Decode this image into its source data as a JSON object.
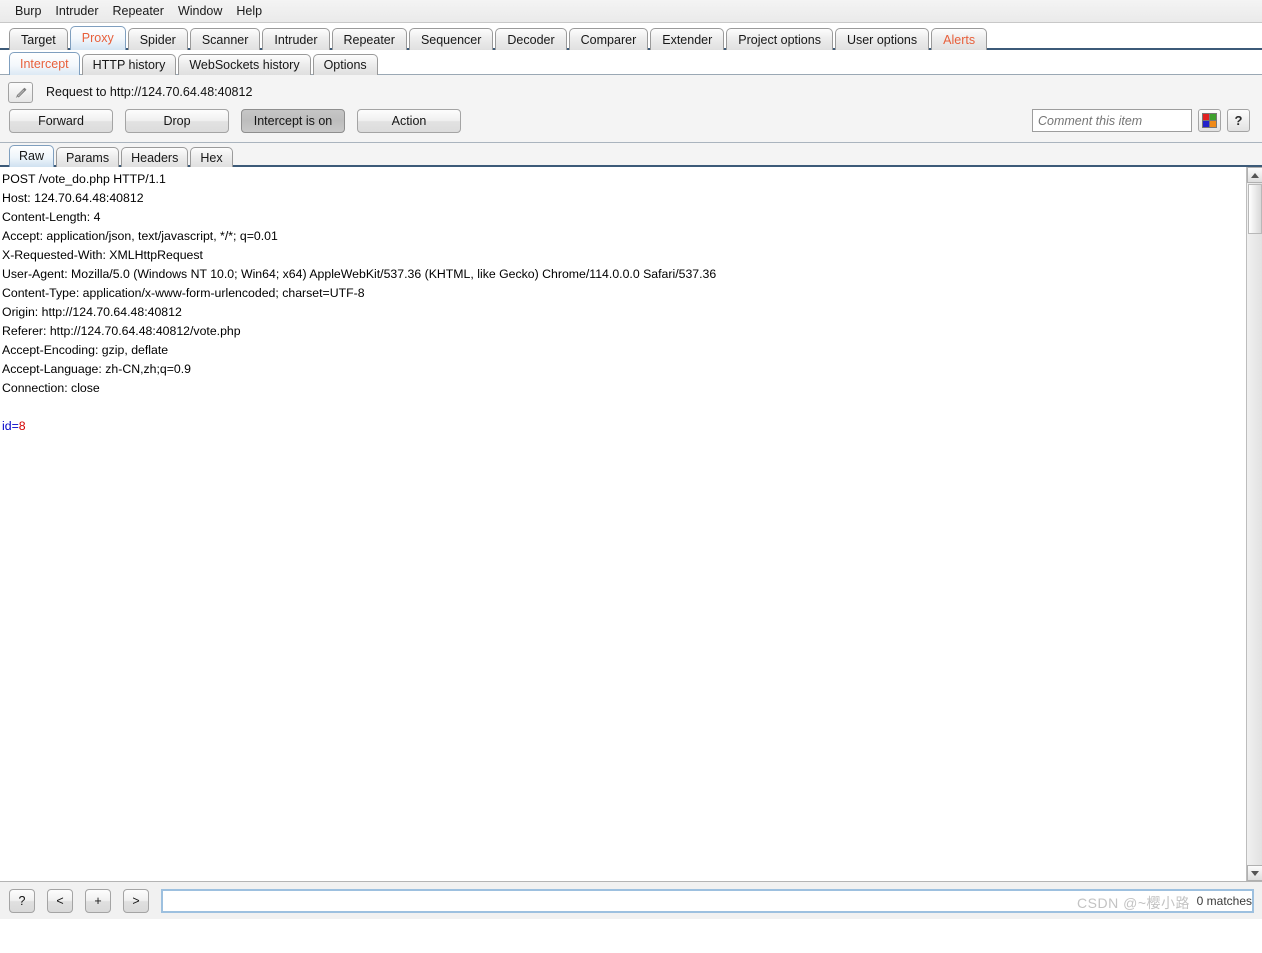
{
  "app": {
    "name": "Burp Suite",
    "accent_orange": "#e8603c",
    "tab_underline": "#3c5a78"
  },
  "menubar": {
    "items": [
      {
        "label": "Burp"
      },
      {
        "label": "Intruder"
      },
      {
        "label": "Repeater"
      },
      {
        "label": "Window"
      },
      {
        "label": "Help"
      }
    ]
  },
  "main_tabs": {
    "selected": "Proxy",
    "items": [
      {
        "label": "Target",
        "state": "normal"
      },
      {
        "label": "Proxy",
        "state": "selected"
      },
      {
        "label": "Spider",
        "state": "normal"
      },
      {
        "label": "Scanner",
        "state": "normal"
      },
      {
        "label": "Intruder",
        "state": "normal"
      },
      {
        "label": "Repeater",
        "state": "normal"
      },
      {
        "label": "Sequencer",
        "state": "normal"
      },
      {
        "label": "Decoder",
        "state": "normal"
      },
      {
        "label": "Comparer",
        "state": "normal"
      },
      {
        "label": "Extender",
        "state": "normal"
      },
      {
        "label": "Project options",
        "state": "normal"
      },
      {
        "label": "User options",
        "state": "normal"
      },
      {
        "label": "Alerts",
        "state": "alert"
      }
    ]
  },
  "sub_tabs": {
    "selected": "Intercept",
    "items": [
      {
        "label": "Intercept",
        "state": "selected"
      },
      {
        "label": "HTTP history",
        "state": "normal"
      },
      {
        "label": "WebSockets history",
        "state": "normal"
      },
      {
        "label": "Options",
        "state": "normal"
      }
    ]
  },
  "intercept": {
    "edit_icon": "pencil-icon",
    "request_title": "Request to http://124.70.64.48:40812",
    "buttons": [
      {
        "label": "Forward",
        "pressed": false
      },
      {
        "label": "Drop",
        "pressed": false
      },
      {
        "label": "Intercept is on",
        "pressed": true
      },
      {
        "label": "Action",
        "pressed": false
      }
    ],
    "comment_placeholder": "Comment this item",
    "comment_value": "",
    "highlight_icon": "color-swatch-icon",
    "highlight_colors": {
      "top_left": "#e02020",
      "top_right": "#3fa02e",
      "bottom_left": "#2222cc",
      "bottom_right": "#f08a18"
    },
    "help_button_label": "?"
  },
  "message_tabs": {
    "selected": "Raw",
    "items": [
      {
        "label": "Raw",
        "state": "selected"
      },
      {
        "label": "Params",
        "state": "normal"
      },
      {
        "label": "Headers",
        "state": "normal"
      },
      {
        "label": "Hex",
        "state": "normal"
      }
    ]
  },
  "request": {
    "lines": [
      "POST /vote_do.php HTTP/1.1",
      "Host: 124.70.64.48:40812",
      "Content-Length: 4",
      "Accept: application/json, text/javascript, */*; q=0.01",
      "X-Requested-With: XMLHttpRequest",
      "User-Agent: Mozilla/5.0 (Windows NT 10.0; Win64; x64) AppleWebKit/537.36 (KHTML, like Gecko) Chrome/114.0.0.0 Safari/537.36",
      "Content-Type: application/x-www-form-urlencoded; charset=UTF-8",
      "Origin: http://124.70.64.48:40812",
      "Referer: http://124.70.64.48:40812/vote.php",
      "Accept-Encoding: gzip, deflate",
      "Accept-Language: zh-CN,zh;q=0.9",
      "Connection: close"
    ],
    "body_param_name": "id",
    "body_equals": "=",
    "body_param_value": "8",
    "body_name_color": "#0000c8",
    "body_value_color": "#d40000"
  },
  "scrollbar": {
    "up_arrow": "triangle-up-icon",
    "down_arrow": "triangle-down-icon"
  },
  "bottom_bar": {
    "help_label": "?",
    "prev_label": "<",
    "add_label": "+",
    "next_label": ">",
    "search_value": "",
    "matches_label": "0 matches"
  },
  "watermark": {
    "text": "CSDN @~樱小路"
  }
}
